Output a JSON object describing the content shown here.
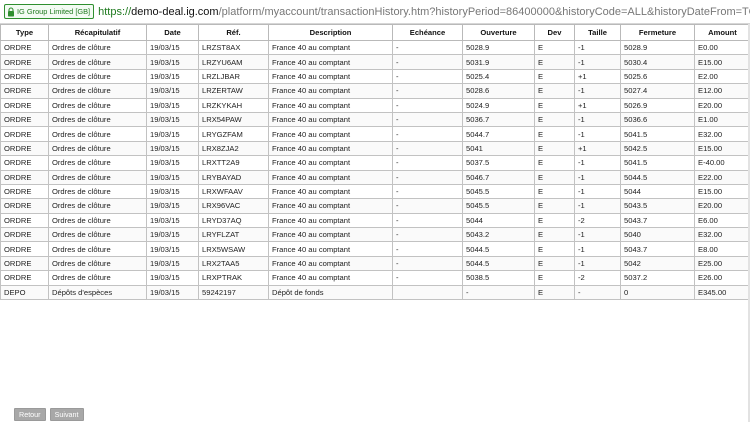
{
  "address_bar": {
    "secure_label": "IG Group Limited [GB]",
    "scheme": "https://",
    "host": "demo-deal.ig.com",
    "path": "/platform/myaccount/transactionHistory.htm?historyPeriod=86400000&historyCode=ALL&historyDateFrom=TOD"
  },
  "table": {
    "columns": [
      "Type",
      "Récapitulatif",
      "Date",
      "Réf.",
      "Description",
      "Echéance",
      "Ouverture",
      "Dev",
      "Taille",
      "Fermeture",
      "Amount"
    ],
    "rows": [
      [
        "ORDRE",
        "Ordres de clôture",
        "19/03/15",
        "LRZST8AX",
        "France 40 au comptant",
        "-",
        "5028.9",
        "E",
        "-1",
        "5028.9",
        "E0.00"
      ],
      [
        "ORDRE",
        "Ordres de clôture",
        "19/03/15",
        "LRZYU6AM",
        "France 40 au comptant",
        "-",
        "5031.9",
        "E",
        "-1",
        "5030.4",
        "E15.00"
      ],
      [
        "ORDRE",
        "Ordres de clôture",
        "19/03/15",
        "LRZLJBAR",
        "France 40 au comptant",
        "-",
        "5025.4",
        "E",
        "+1",
        "5025.6",
        "E2.00"
      ],
      [
        "ORDRE",
        "Ordres de clôture",
        "19/03/15",
        "LRZERTAW",
        "France 40 au comptant",
        "-",
        "5028.6",
        "E",
        "-1",
        "5027.4",
        "E12.00"
      ],
      [
        "ORDRE",
        "Ordres de clôture",
        "19/03/15",
        "LRZKYKAH",
        "France 40 au comptant",
        "-",
        "5024.9",
        "E",
        "+1",
        "5026.9",
        "E20.00"
      ],
      [
        "ORDRE",
        "Ordres de clôture",
        "19/03/15",
        "LRX54PAW",
        "France 40 au comptant",
        "-",
        "5036.7",
        "E",
        "-1",
        "5036.6",
        "E1.00"
      ],
      [
        "ORDRE",
        "Ordres de clôture",
        "19/03/15",
        "LRYGZFAM",
        "France 40 au comptant",
        "-",
        "5044.7",
        "E",
        "-1",
        "5041.5",
        "E32.00"
      ],
      [
        "ORDRE",
        "Ordres de clôture",
        "19/03/15",
        "LRX8ZJA2",
        "France 40 au comptant",
        "-",
        "5041",
        "E",
        "+1",
        "5042.5",
        "E15.00"
      ],
      [
        "ORDRE",
        "Ordres de clôture",
        "19/03/15",
        "LRXTT2A9",
        "France 40 au comptant",
        "-",
        "5037.5",
        "E",
        "-1",
        "5041.5",
        "E-40.00"
      ],
      [
        "ORDRE",
        "Ordres de clôture",
        "19/03/15",
        "LRYBAYAD",
        "France 40 au comptant",
        "-",
        "5046.7",
        "E",
        "-1",
        "5044.5",
        "E22.00"
      ],
      [
        "ORDRE",
        "Ordres de clôture",
        "19/03/15",
        "LRXWFAAV",
        "France 40 au comptant",
        "-",
        "5045.5",
        "E",
        "-1",
        "5044",
        "E15.00"
      ],
      [
        "ORDRE",
        "Ordres de clôture",
        "19/03/15",
        "LRX96VAC",
        "France 40 au comptant",
        "-",
        "5045.5",
        "E",
        "-1",
        "5043.5",
        "E20.00"
      ],
      [
        "ORDRE",
        "Ordres de clôture",
        "19/03/15",
        "LRYD37AQ",
        "France 40 au comptant",
        "-",
        "5044",
        "E",
        "-2",
        "5043.7",
        "E6.00"
      ],
      [
        "ORDRE",
        "Ordres de clôture",
        "19/03/15",
        "LRYFLZAT",
        "France 40 au comptant",
        "-",
        "5043.2",
        "E",
        "-1",
        "5040",
        "E32.00"
      ],
      [
        "ORDRE",
        "Ordres de clôture",
        "19/03/15",
        "LRX5WSAW",
        "France 40 au comptant",
        "-",
        "5044.5",
        "E",
        "-1",
        "5043.7",
        "E8.00"
      ],
      [
        "ORDRE",
        "Ordres de clôture",
        "19/03/15",
        "LRX2TAA5",
        "France 40 au comptant",
        "-",
        "5044.5",
        "E",
        "-1",
        "5042",
        "E25.00"
      ],
      [
        "ORDRE",
        "Ordres de clôture",
        "19/03/15",
        "LRXPTRAK",
        "France 40 au comptant",
        "-",
        "5038.5",
        "E",
        "-2",
        "5037.2",
        "E26.00"
      ],
      [
        "DEPO",
        "Dépôts d'espèces",
        "19/03/15",
        "59242197",
        "Dépôt de fonds",
        "",
        "-",
        "E",
        "-",
        "0",
        "E345.00"
      ]
    ]
  },
  "pager": {
    "back_label": "Retour",
    "next_label": "Suivant"
  },
  "colors": {
    "secure_green": "#1f7a1f",
    "button_gray": "#a8a8a8",
    "grid_border": "#c2c2c2"
  }
}
